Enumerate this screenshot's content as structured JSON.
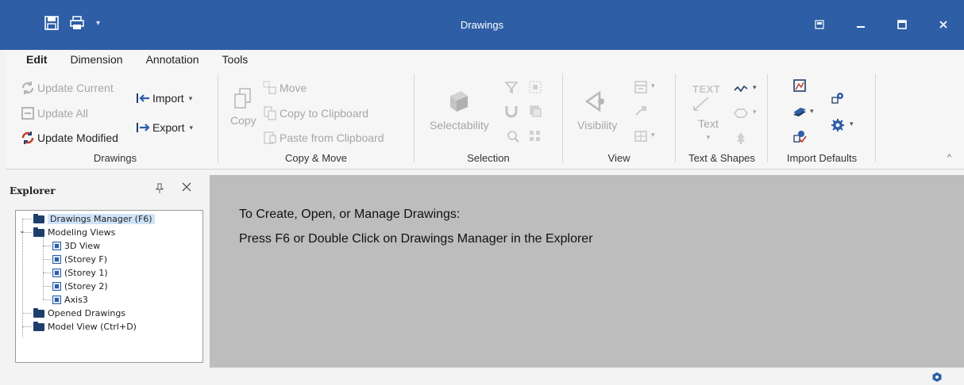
{
  "window": {
    "title": "Drawings",
    "controls": [
      "restore-ribbon-icon",
      "minimize-icon",
      "maximize-icon",
      "close-icon"
    ]
  },
  "quick_access": [
    "save-icon",
    "print-icon",
    "customize-dropdown-icon"
  ],
  "tabs": [
    {
      "label": "Edit",
      "active": true
    },
    {
      "label": "Dimension",
      "active": false
    },
    {
      "label": "Annotation",
      "active": false
    },
    {
      "label": "Tools",
      "active": false
    }
  ],
  "ribbon": {
    "drawings": {
      "label": "Drawings",
      "update_current": "Update Current",
      "update_all": "Update All",
      "update_modified": "Update Modified",
      "import": "Import",
      "export": "Export"
    },
    "copy_move": {
      "label": "Copy & Move",
      "copy": "Copy",
      "move": "Move",
      "copy_to_clipboard": "Copy to Clipboard",
      "paste_from_clipboard": "Paste from Clipboard"
    },
    "selection": {
      "label": "Selection",
      "selectability": "Selectability"
    },
    "view": {
      "label": "View",
      "visibility": "Visibility"
    },
    "text_shapes": {
      "label": "Text & Shapes",
      "text": "Text",
      "text_icon": "TEXT"
    },
    "import_defaults": {
      "label": "Import Defaults"
    }
  },
  "explorer": {
    "title": "Explorer",
    "tree": {
      "drawings_manager": "Drawings Manager (F6)",
      "modeling_views": "Modeling Views",
      "views": [
        "3D View",
        "(Storey F)",
        "(Storey 1)",
        "(Storey 2)",
        "Axis3"
      ],
      "opened_drawings": "Opened Drawings",
      "model_view": "Model View (Ctrl+D)"
    }
  },
  "main": {
    "line1": "To Create, Open, or Manage Drawings:",
    "line2": "Press F6 or Double Click on Drawings Manager in the Explorer"
  },
  "colors": {
    "titlebar": "#2d5ea6",
    "workspace": "#bdbdbd",
    "selection": "#cfe3f8",
    "accent_red": "#c0392b"
  }
}
